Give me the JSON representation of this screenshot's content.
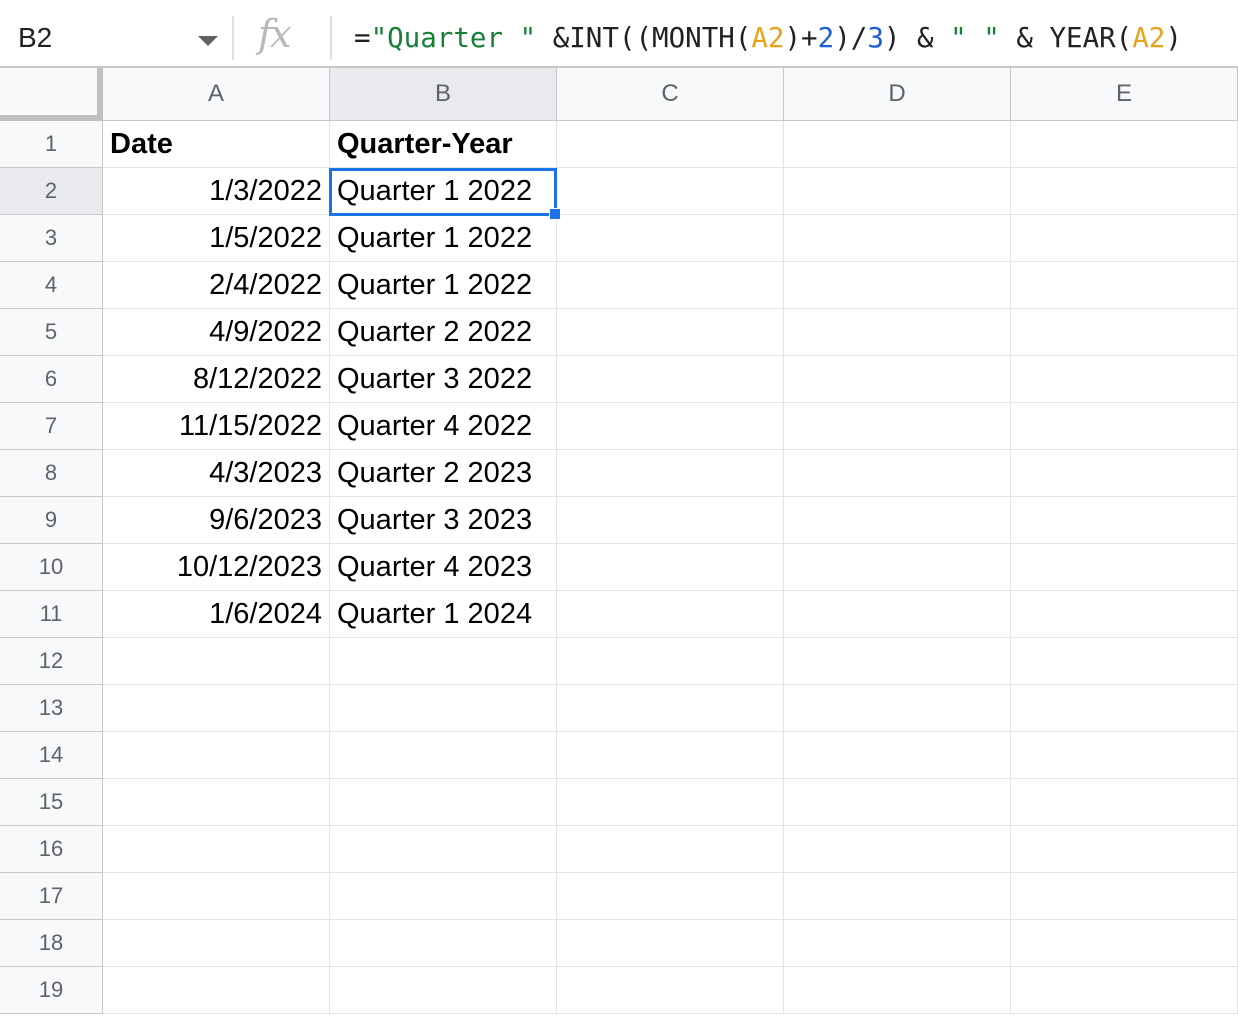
{
  "formula_bar": {
    "cell_ref": "B2",
    "fx_label": "fx",
    "formula_tokens": [
      {
        "text": "=",
        "color": "#202124"
      },
      {
        "text": "\"Quarter \"",
        "color": "#188038"
      },
      {
        "text": " &INT((MONTH(",
        "color": "#202124"
      },
      {
        "text": "A2",
        "color": "#e8a318"
      },
      {
        "text": ")+",
        "color": "#202124"
      },
      {
        "text": "2",
        "color": "#1a5fd6"
      },
      {
        "text": ")/",
        "color": "#202124"
      },
      {
        "text": "3",
        "color": "#1a5fd6"
      },
      {
        "text": ") & ",
        "color": "#202124"
      },
      {
        "text": "\" \"",
        "color": "#188038"
      },
      {
        "text": " & YEAR(",
        "color": "#202124"
      },
      {
        "text": "A2",
        "color": "#e8a318"
      },
      {
        "text": ")",
        "color": "#202124"
      }
    ]
  },
  "columns": [
    "A",
    "B",
    "C",
    "D",
    "E"
  ],
  "active_column": "B",
  "active_row": 2,
  "row_numbers": [
    "1",
    "2",
    "3",
    "4",
    "5",
    "6",
    "7",
    "8",
    "9",
    "10",
    "11",
    "12",
    "13",
    "14",
    "15",
    "16",
    "17",
    "18",
    "19"
  ],
  "header_row": {
    "date": "Date",
    "quarter_year": "Quarter-Year"
  },
  "rows": [
    {
      "date": "1/3/2022",
      "quarter": "Quarter 1 2022"
    },
    {
      "date": "1/5/2022",
      "quarter": "Quarter 1 2022"
    },
    {
      "date": "2/4/2022",
      "quarter": "Quarter 1 2022"
    },
    {
      "date": "4/9/2022",
      "quarter": "Quarter 2 2022"
    },
    {
      "date": "8/12/2022",
      "quarter": "Quarter 3 2022"
    },
    {
      "date": "11/15/2022",
      "quarter": "Quarter 4 2022"
    },
    {
      "date": "4/3/2023",
      "quarter": "Quarter 2 2023"
    },
    {
      "date": "9/6/2023",
      "quarter": "Quarter 3 2023"
    },
    {
      "date": "10/12/2023",
      "quarter": "Quarter 4 2023"
    },
    {
      "date": "1/6/2024",
      "quarter": "Quarter 1 2024"
    }
  ],
  "colors": {
    "selection": "#1a73e8",
    "header_bg": "#f8f9fa",
    "active_header_bg": "#e8eaed"
  }
}
